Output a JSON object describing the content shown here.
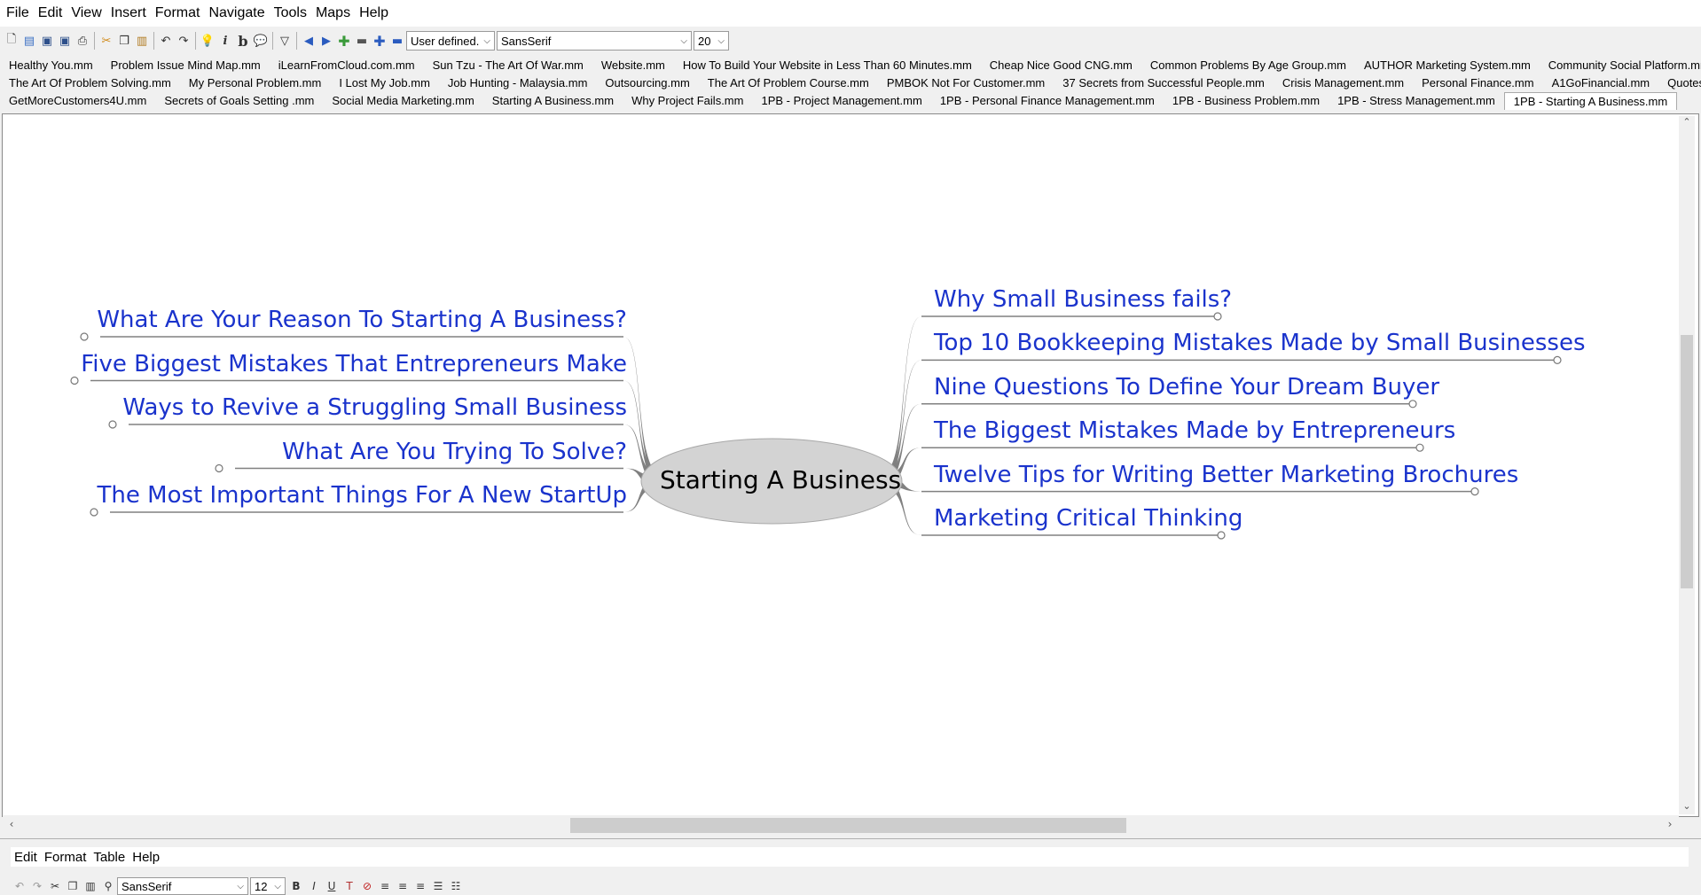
{
  "menubar": [
    "File",
    "Edit",
    "View",
    "Insert",
    "Format",
    "Navigate",
    "Tools",
    "Maps",
    "Help"
  ],
  "toolbar": {
    "icons_left": [
      "new-icon",
      "open-icon",
      "save-icon",
      "save-as-icon",
      "print-icon",
      "cut-icon",
      "copy-icon",
      "paste-icon",
      "undo-icon",
      "redo-icon",
      "bulb-icon",
      "italic-icon",
      "bold-icon",
      "cloud-icon",
      "filter-icon",
      "nav-left-icon",
      "nav-right-icon",
      "add-icon",
      "remove-icon",
      "add-node-icon",
      "remove-node-icon"
    ],
    "style_select": "User defined.",
    "font_select": "SansSerif",
    "size_select": "20"
  },
  "tabs": {
    "row1": [
      "Healthy You.mm",
      "Problem Issue Mind Map.mm",
      "iLearnFromCloud.com.mm",
      "Sun Tzu - The Art Of War.mm",
      "Website.mm",
      "How To Build Your Website in Less Than 60 Minutes.mm",
      "Cheap Nice Good CNG.mm",
      "Common Problems By Age Group.mm",
      "AUTHOR Marketing System.mm",
      "Community Social Platform.mm"
    ],
    "row2": [
      "The Art Of Problem Solving.mm",
      "My Personal Problem.mm",
      "I Lost My Job.mm",
      "Job Hunting - Malaysia.mm",
      "Outsourcing.mm",
      "The Art Of Problem Course.mm",
      "PMBOK Not For Customer.mm",
      "37 Secrets from Successful People.mm",
      "Crisis Management.mm",
      "Personal Finance.mm",
      "A1GoFinancial.mm",
      "Quotes Ideas.mm"
    ],
    "row3": [
      "GetMoreCustomers4U.mm",
      "Secrets of Goals Setting .mm",
      "Social Media Marketing.mm",
      "Starting A Business.mm",
      "Why Project Fails.mm",
      "1PB - Project Management.mm",
      "1PB - Personal Finance Management.mm",
      "1PB - Business Problem.mm",
      "1PB - Stress Management.mm",
      "1PB - Starting A Business.mm"
    ],
    "active": "1PB - Starting A Business.mm"
  },
  "mindmap": {
    "root": "Starting A Business",
    "left": [
      "What Are Your Reason To Starting A Business?",
      "Five Biggest Mistakes That Entrepreneurs Make",
      "Ways to Revive a Struggling Small Business",
      "What Are You Trying To Solve?",
      "The Most Important Things For A New StartUp"
    ],
    "right": [
      "Why Small Business fails?",
      "Top 10 Bookkeeping Mistakes Made by Small Businesses",
      "Nine Questions To Define Your Dream Buyer",
      "The Biggest Mistakes Made by Entrepreneurs",
      "Twelve Tips for Writing Better Marketing Brochures",
      "Marketing Critical Thinking"
    ],
    "node_color": "#1a33cc",
    "edge_color": "#808080",
    "root_fill": "#d3d3d3"
  },
  "editor": {
    "menu": [
      "Edit",
      "Format",
      "Table",
      "Help"
    ],
    "font_select": "SansSerif",
    "size_select": "12"
  }
}
